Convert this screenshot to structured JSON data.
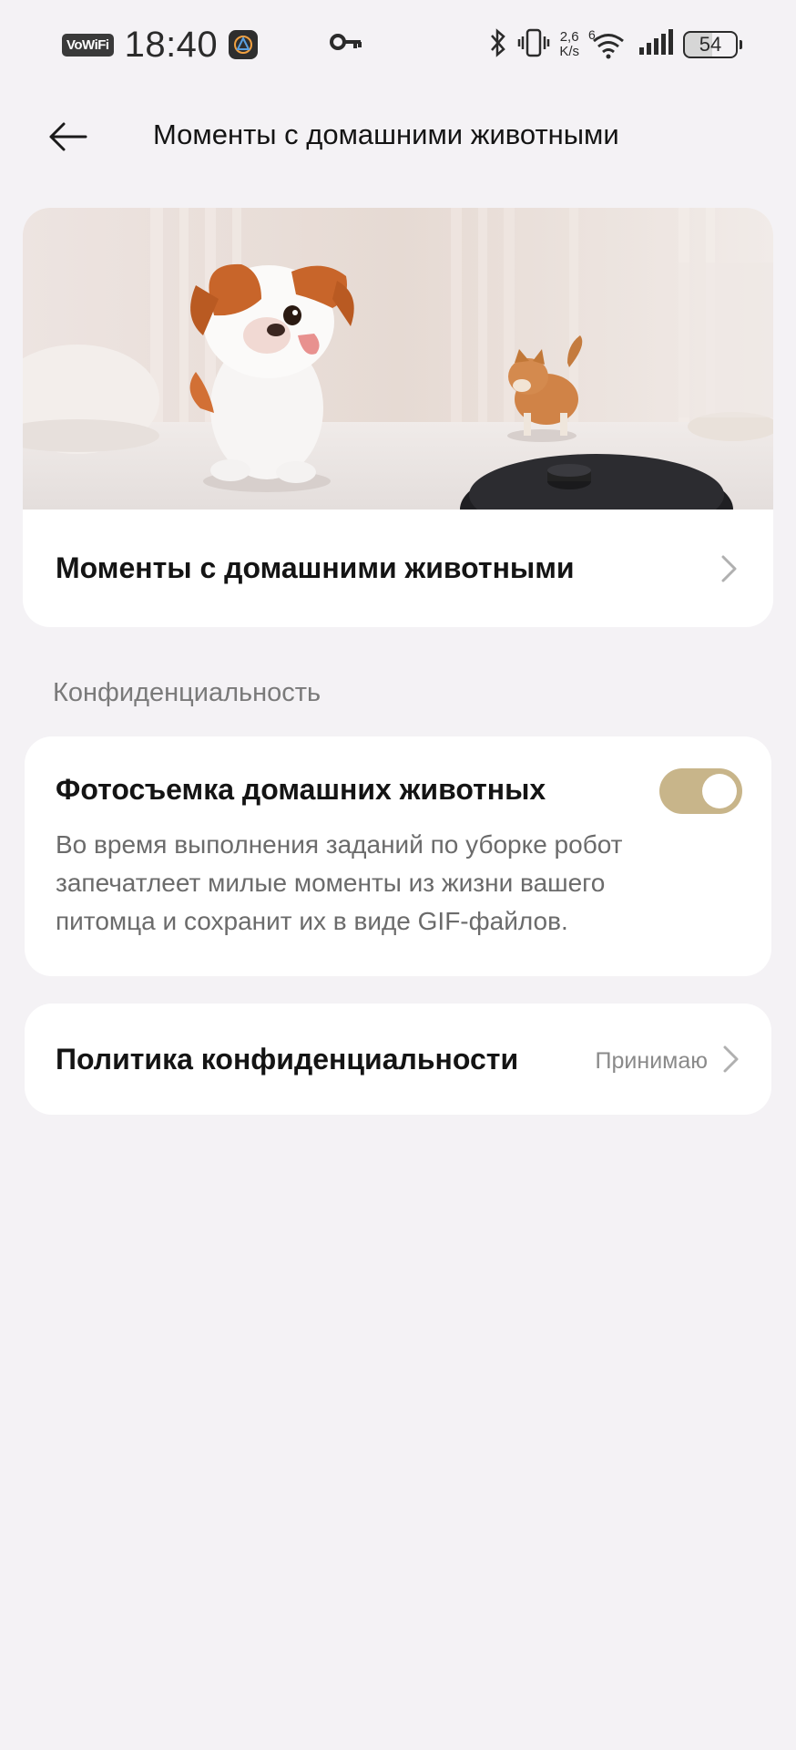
{
  "status_bar": {
    "vowifi": "VoWiFi",
    "time": "18:40",
    "net_speed_value": "2,6",
    "net_speed_unit": "K/s",
    "wifi_badge": "6",
    "battery": "54",
    "icons": [
      "key-icon",
      "bluetooth-icon",
      "vibrate-icon",
      "wifi-icon",
      "signal-icon",
      "battery-icon"
    ]
  },
  "header": {
    "title": "Моменты с домашними животными",
    "back_icon": "arrow-left-icon"
  },
  "hero": {
    "row_title": "Моменты с домашними животными",
    "chevron_icon": "chevron-right-icon"
  },
  "privacy_section": {
    "label": "Конфиденциальность"
  },
  "pet_photo": {
    "title": "Фотосъемка домашних животных",
    "description": "Во время выполнения заданий по уборке робот запечатлеет милые моменты из жизни вашего питомца и сохранит их в виде GIF-файлов.",
    "toggle_on": true
  },
  "privacy_policy": {
    "title": "Политика конфиденциальности",
    "status": "Принимаю",
    "chevron_icon": "chevron-right-icon"
  },
  "colors": {
    "background": "#f4f2f5",
    "card": "#ffffff",
    "toggle_on": "#c8b58a",
    "secondary_text": "#6b6b6b"
  }
}
